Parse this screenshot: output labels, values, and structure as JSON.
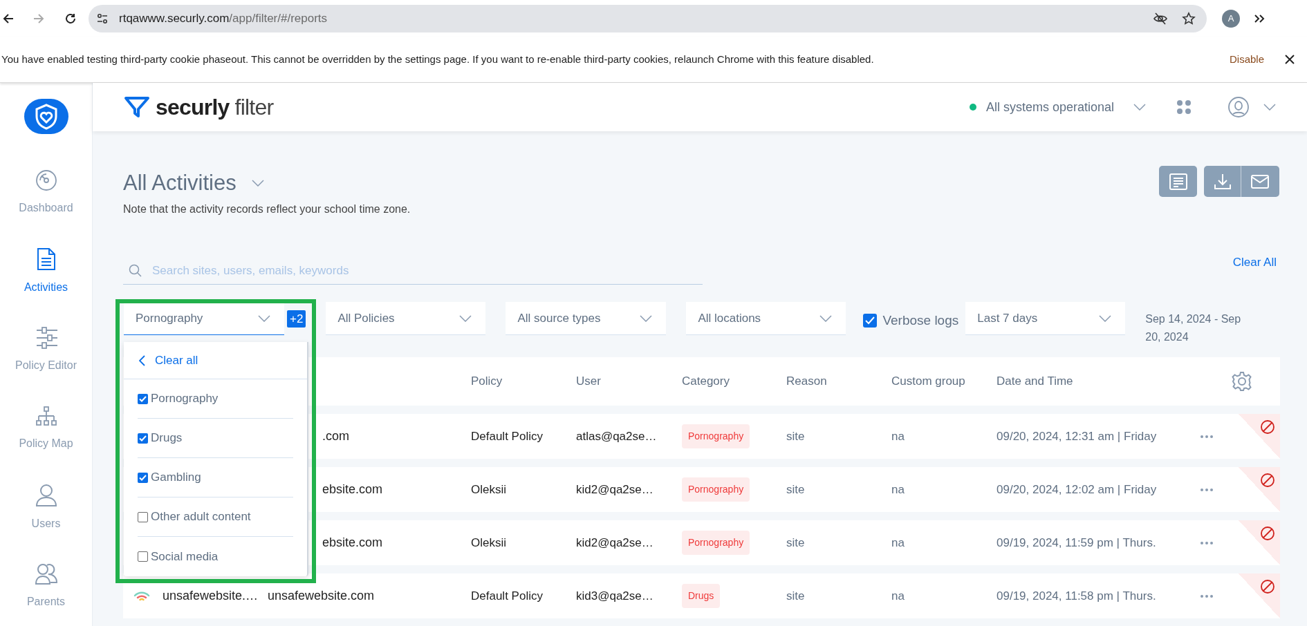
{
  "browser": {
    "url_domain": "rtqawww.securly.com",
    "url_path": "/app/filter/#/reports",
    "profile_initial": "A"
  },
  "cookie_banner": {
    "message": "You have enabled testing third-party cookie phaseout. This cannot be overridden by the settings page. If you want to re-enable third-party cookies, relaunch Chrome with this feature disabled.",
    "action": "Disable"
  },
  "sidebar": {
    "items": [
      {
        "label": "Dashboard",
        "kind": "gauge",
        "selected": false
      },
      {
        "label": "Activities",
        "kind": "document",
        "selected": true
      },
      {
        "label": "Policy Editor",
        "kind": "sliders",
        "selected": false
      },
      {
        "label": "Policy Map",
        "kind": "hierarchy",
        "selected": false
      },
      {
        "label": "Users",
        "kind": "person",
        "selected": false
      },
      {
        "label": "Parents",
        "kind": "people",
        "selected": false
      }
    ]
  },
  "header": {
    "brand_bold": "securly",
    "brand_light": "filter",
    "status": {
      "text": "All systems operational",
      "color": "#10b981"
    }
  },
  "page": {
    "title": "All Activities",
    "note": "Note that the activity records reflect your school time zone.",
    "search_placeholder": "Search sites, users, emails, keywords",
    "clear_all": "Clear All"
  },
  "filters": [
    {
      "kind": "dropdown",
      "value": "Pornography",
      "badge": "+2",
      "expanded": true
    },
    {
      "kind": "dropdown",
      "value": "All Policies",
      "expanded": false
    },
    {
      "kind": "dropdown",
      "value": "All source types",
      "expanded": false
    },
    {
      "kind": "dropdown",
      "value": "All locations",
      "expanded": false
    },
    {
      "kind": "checkbox",
      "label": "Verbose logs",
      "checked": true
    },
    {
      "kind": "dropdown",
      "value": "Last 7 days",
      "expanded": false
    },
    {
      "kind": "text",
      "value": "Sep 14, 2024 -  Sep 20, 2024"
    }
  ],
  "category_menu": {
    "clear": "Clear all",
    "options": [
      {
        "label": "Pornography",
        "checked": true
      },
      {
        "label": "Drugs",
        "checked": true
      },
      {
        "label": "Gambling",
        "checked": true
      },
      {
        "label": "Other adult content",
        "checked": false
      },
      {
        "label": "Social media",
        "checked": false
      }
    ]
  },
  "table": {
    "columns": [
      "Policy",
      "User",
      "Category",
      "Reason",
      "Custom group",
      "Date and Time"
    ],
    "rows": [
      {
        "domain": ".com",
        "policy": "Default Policy",
        "user": "atlas@qa2se…",
        "category": "Pornography",
        "reason": "site",
        "custom_group": "na",
        "datetime": "09/20, 2024, 12:31 am | Friday",
        "blocked": true
      },
      {
        "domain": "ebsite.com",
        "policy": "Oleksii",
        "user": "kid2@qa2se…",
        "category": "Pornography",
        "reason": "site",
        "custom_group": "na",
        "datetime": "09/20, 2024, 12:02 am | Friday",
        "blocked": true
      },
      {
        "domain": "ebsite.com",
        "policy": "Oleksii",
        "user": "kid2@qa2se…",
        "category": "Pornography",
        "reason": "site",
        "custom_group": "na",
        "datetime": "09/19, 2024, 11:59 pm | Thurs.",
        "blocked": true
      },
      {
        "site": "unsafewebsite.…",
        "domain": "unsafewebsite.com",
        "policy": "Default Policy",
        "user": "kid3@qa2se…",
        "category": "Drugs",
        "reason": "site",
        "custom_group": "na",
        "datetime": "09/19, 2024, 11:58 pm | Thurs.",
        "blocked": true
      }
    ]
  }
}
